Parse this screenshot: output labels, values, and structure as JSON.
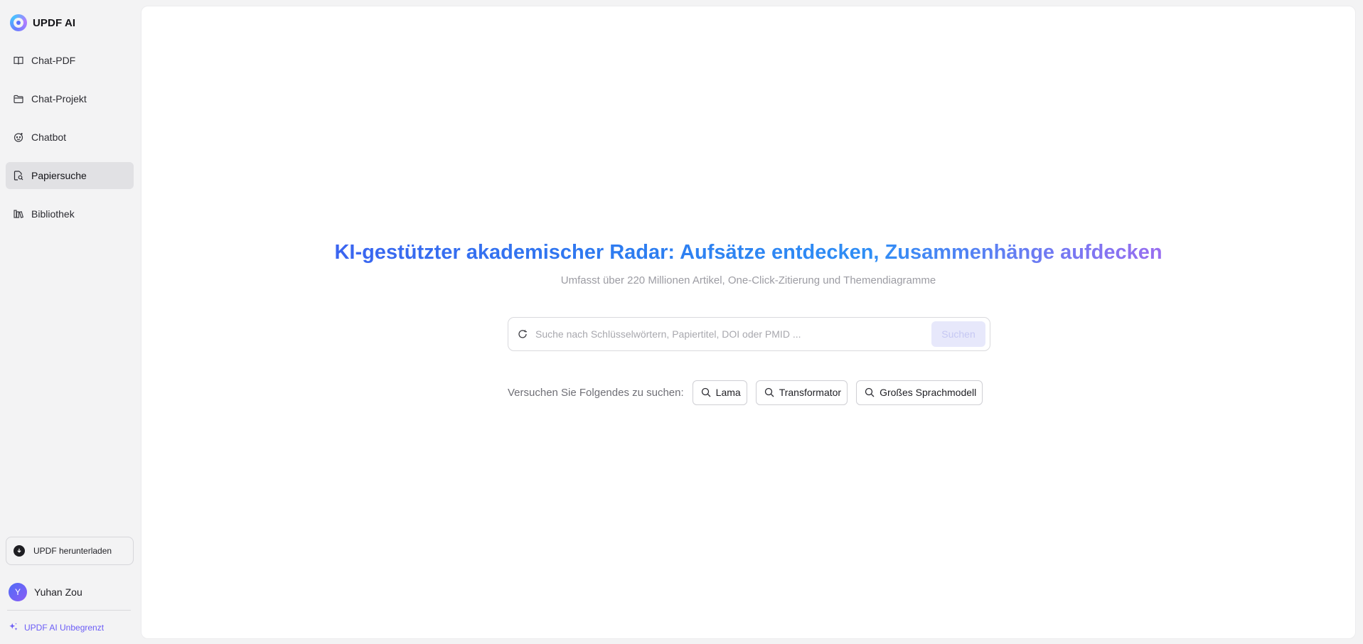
{
  "brand": {
    "name": "UPDF AI"
  },
  "nav": {
    "items": [
      {
        "label": "Chat-PDF",
        "icon": "book-open-icon"
      },
      {
        "label": "Chat-Projekt",
        "icon": "folder-icon"
      },
      {
        "label": "Chatbot",
        "icon": "bot-face-icon"
      },
      {
        "label": "Papiersuche",
        "icon": "document-search-icon",
        "active": true
      },
      {
        "label": "Bibliothek",
        "icon": "library-icon"
      }
    ]
  },
  "sidebar_footer": {
    "download_label": "UPDF herunterladen",
    "user_initial": "Y",
    "user_name": "Yuhan Zou",
    "plan_label": "UPDF AI Unbegrenzt"
  },
  "hero": {
    "title": "KI-gestützter akademischer Radar: Aufsätze entdecken, Zusammenhänge aufdecken",
    "subtitle": "Umfasst über 220 Millionen Artikel, One-Click-Zitierung und Themendiagramme"
  },
  "search": {
    "placeholder": "Suche nach Schlüsselwörtern, Papiertitel, DOI oder PMID ...",
    "value": "",
    "button_label": "Suchen"
  },
  "suggestions": {
    "label": "Versuchen Sie Folgendes zu suchen:",
    "chips": [
      "Lama",
      "Transformator",
      "Großes Sprachmodell"
    ]
  },
  "colors": {
    "accent": "#4455f0",
    "accent_end": "#c07af2",
    "plan_purple": "#6b5cf6"
  }
}
